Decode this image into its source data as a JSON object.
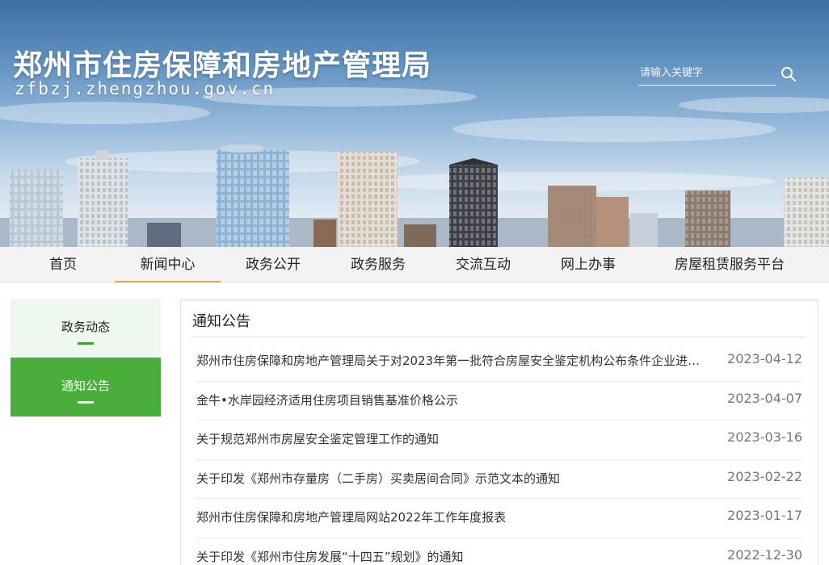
{
  "header": {
    "site_title": "郑州市住房保障和房地产管理局",
    "site_domain": "zfbzj.zhengzhou.gov.cn"
  },
  "search": {
    "placeholder": "请输入关键字",
    "icon": "search-icon"
  },
  "nav": {
    "items": [
      {
        "label": "首页"
      },
      {
        "label": "新闻中心"
      },
      {
        "label": "政务公开"
      },
      {
        "label": "政务服务"
      },
      {
        "label": "交流互动"
      },
      {
        "label": "网上办事"
      },
      {
        "label": "房屋租赁服务平台"
      }
    ],
    "active_label": "新闻中心"
  },
  "sidebar": {
    "items": [
      {
        "label": "政务动态"
      },
      {
        "label": "通知公告"
      }
    ],
    "active_label": "通知公告"
  },
  "main": {
    "title": "通知公告",
    "items": [
      {
        "title": "郑州市住房保障和房地产管理局关于对2023年第一批符合房屋安全鉴定机构公布条件企业进…",
        "date": "2023-04-12"
      },
      {
        "title": "金牛•水岸园经济适用住房项目销售基准价格公示",
        "date": "2023-04-07"
      },
      {
        "title": "关于规范郑州市房屋安全鉴定管理工作的通知",
        "date": "2023-03-16"
      },
      {
        "title": "关于印发《郑州市存量房（二手房）买卖居间合同》示范文本的通知",
        "date": "2023-02-22"
      },
      {
        "title": "郑州市住房保障和房地产管理局网站2022年工作年度报表",
        "date": "2023-01-17"
      },
      {
        "title": "关于印发《郑州市住房发展“十四五”规划》的通知",
        "date": "2022-12-30"
      }
    ]
  },
  "colors": {
    "accent_green": "#4aae3a",
    "nav_active_underline": "#e0a448",
    "nav_background": "#f3f3f3"
  }
}
